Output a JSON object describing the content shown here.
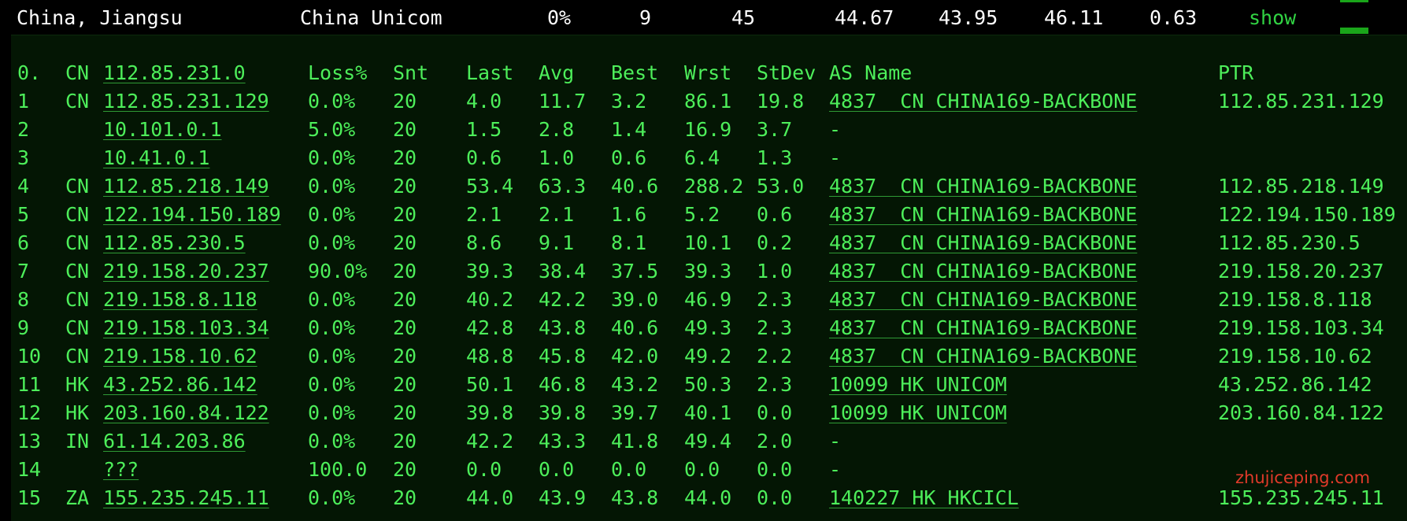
{
  "summary": {
    "location": "China, Jiangsu",
    "isp": "China Unicom",
    "loss": "0%",
    "hops": "9",
    "sent": "45",
    "last": "44.67",
    "avg": "43.95",
    "best": "46.11",
    "stdev": "0.63",
    "action": "show"
  },
  "table": {
    "header": {
      "hop": "0.",
      "cc": "CN",
      "host": "112.85.231.0",
      "loss": "Loss%",
      "snt": "Snt",
      "last": "Last",
      "avg": "Avg",
      "best": "Best",
      "wrst": "Wrst",
      "stdev": "StDev",
      "as_name": "AS Name",
      "ptr": "PTR"
    },
    "rows": [
      {
        "hop": "1",
        "cc": "CN",
        "host": "112.85.231.129",
        "loss": "0.0%",
        "snt": "20",
        "last": "4.0",
        "avg": "11.7",
        "best": "3.2",
        "wrst": "86.1",
        "stdev": "19.8",
        "as_name": "4837  CN CHINA169-BACKBONE",
        "ptr": "112.85.231.129"
      },
      {
        "hop": "2",
        "cc": "",
        "host": "10.101.0.1",
        "loss": "5.0%",
        "snt": "20",
        "last": "1.5",
        "avg": "2.8",
        "best": "1.4",
        "wrst": "16.9",
        "stdev": "3.7",
        "as_name": "-",
        "ptr": ""
      },
      {
        "hop": "3",
        "cc": "",
        "host": "10.41.0.1",
        "loss": "0.0%",
        "snt": "20",
        "last": "0.6",
        "avg": "1.0",
        "best": "0.6",
        "wrst": "6.4",
        "stdev": "1.3",
        "as_name": "-",
        "ptr": ""
      },
      {
        "hop": "4",
        "cc": "CN",
        "host": "112.85.218.149",
        "loss": "0.0%",
        "snt": "20",
        "last": "53.4",
        "avg": "63.3",
        "best": "40.6",
        "wrst": "288.2",
        "stdev": "53.0",
        "as_name": "4837  CN CHINA169-BACKBONE",
        "ptr": "112.85.218.149"
      },
      {
        "hop": "5",
        "cc": "CN",
        "host": "122.194.150.189",
        "loss": "0.0%",
        "snt": "20",
        "last": "2.1",
        "avg": "2.1",
        "best": "1.6",
        "wrst": "5.2",
        "stdev": "0.6",
        "as_name": "4837  CN CHINA169-BACKBONE",
        "ptr": "122.194.150.189"
      },
      {
        "hop": "6",
        "cc": "CN",
        "host": "112.85.230.5",
        "loss": "0.0%",
        "snt": "20",
        "last": "8.6",
        "avg": "9.1",
        "best": "8.1",
        "wrst": "10.1",
        "stdev": "0.2",
        "as_name": "4837  CN CHINA169-BACKBONE",
        "ptr": "112.85.230.5"
      },
      {
        "hop": "7",
        "cc": "CN",
        "host": "219.158.20.237",
        "loss": "90.0%",
        "snt": "20",
        "last": "39.3",
        "avg": "38.4",
        "best": "37.5",
        "wrst": "39.3",
        "stdev": "1.0",
        "as_name": "4837  CN CHINA169-BACKBONE",
        "ptr": "219.158.20.237"
      },
      {
        "hop": "8",
        "cc": "CN",
        "host": "219.158.8.118",
        "loss": "0.0%",
        "snt": "20",
        "last": "40.2",
        "avg": "42.2",
        "best": "39.0",
        "wrst": "46.9",
        "stdev": "2.3",
        "as_name": "4837  CN CHINA169-BACKBONE",
        "ptr": "219.158.8.118"
      },
      {
        "hop": "9",
        "cc": "CN",
        "host": "219.158.103.34",
        "loss": "0.0%",
        "snt": "20",
        "last": "42.8",
        "avg": "43.8",
        "best": "40.6",
        "wrst": "49.3",
        "stdev": "2.3",
        "as_name": "4837  CN CHINA169-BACKBONE",
        "ptr": "219.158.103.34"
      },
      {
        "hop": "10",
        "cc": "CN",
        "host": "219.158.10.62",
        "loss": "0.0%",
        "snt": "20",
        "last": "48.8",
        "avg": "45.8",
        "best": "42.0",
        "wrst": "49.2",
        "stdev": "2.2",
        "as_name": "4837  CN CHINA169-BACKBONE",
        "ptr": "219.158.10.62"
      },
      {
        "hop": "11",
        "cc": "HK",
        "host": "43.252.86.142",
        "loss": "0.0%",
        "snt": "20",
        "last": "50.1",
        "avg": "46.8",
        "best": "43.2",
        "wrst": "50.3",
        "stdev": "2.3",
        "as_name": "10099 HK UNICOM",
        "ptr": "43.252.86.142"
      },
      {
        "hop": "12",
        "cc": "HK",
        "host": "203.160.84.122",
        "loss": "0.0%",
        "snt": "20",
        "last": "39.8",
        "avg": "39.8",
        "best": "39.7",
        "wrst": "40.1",
        "stdev": "0.0",
        "as_name": "10099 HK UNICOM",
        "ptr": "203.160.84.122"
      },
      {
        "hop": "13",
        "cc": "IN",
        "host": "61.14.203.86",
        "loss": "0.0%",
        "snt": "20",
        "last": "42.2",
        "avg": "43.3",
        "best": "41.8",
        "wrst": "49.4",
        "stdev": "2.0",
        "as_name": "-",
        "ptr": ""
      },
      {
        "hop": "14",
        "cc": "",
        "host": "???",
        "loss": "100.0",
        "snt": "20",
        "last": "0.0",
        "avg": "0.0",
        "best": "0.0",
        "wrst": "0.0",
        "stdev": "0.0",
        "as_name": "-",
        "ptr": ""
      },
      {
        "hop": "15",
        "cc": "ZA",
        "host": "155.235.245.11",
        "loss": "0.0%",
        "snt": "20",
        "last": "44.0",
        "avg": "43.9",
        "best": "43.8",
        "wrst": "44.0",
        "stdev": "0.0",
        "as_name": "140227 HK HKCICL",
        "ptr": "155.235.245.11"
      }
    ]
  },
  "watermark": "zhujiceping.com",
  "colors": {
    "text_green": "#4dee5a",
    "show_link": "#31d343",
    "panel_bg": "#041604",
    "page_bg": "#000000",
    "summary_text": "#ffffff",
    "watermark": "#e13a2a",
    "bar": "#1aa51a"
  }
}
